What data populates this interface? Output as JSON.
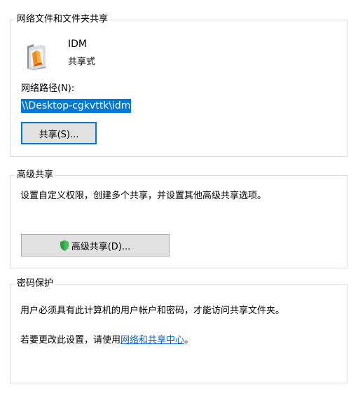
{
  "network_sharing": {
    "title": "网络文件和文件夹共享",
    "share_name": "IDM",
    "share_status": "共享式",
    "path_label": "网络路径(N):",
    "path_value": "\\\\Desktop-cgkvttk\\idm",
    "share_button": "共享(S)..."
  },
  "advanced_sharing": {
    "title": "高级共享",
    "description": "设置自定义权限，创建多个共享，并设置其他高级共享选项。",
    "button": "高级共享(D)...",
    "button_icon": "shield-icon"
  },
  "password_protection": {
    "title": "密码保护",
    "line1": "用户必须具有此计算机的用户帐户和密码，才能访问共享文件夹。",
    "line2_prefix": "若要更改此设置，请使用",
    "line2_link": "网络和共享中心",
    "line2_suffix": "。"
  },
  "colors": {
    "selection": "#0078d7",
    "link": "#0066cc",
    "group_border": "#dcdcdc",
    "button_face": "#e1e1e1"
  }
}
